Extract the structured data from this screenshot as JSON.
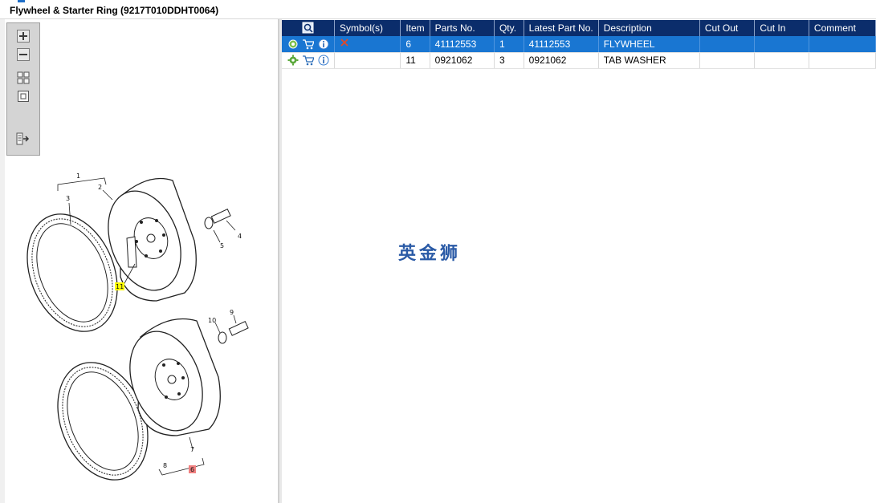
{
  "window": {
    "title": "Flywheel & Starter Ring (9217T010DDHT0064)"
  },
  "zoom_toolbar": {
    "buttons": [
      {
        "name": "zoom-in-icon"
      },
      {
        "name": "zoom-out-icon"
      },
      {
        "name": "fit-all-icon"
      },
      {
        "name": "actual-size-icon"
      },
      {
        "name": "export-icon"
      }
    ]
  },
  "diagram": {
    "callouts": [
      "1",
      "2",
      "3",
      "4",
      "5",
      "6",
      "7",
      "8",
      "9",
      "10",
      "11"
    ],
    "highlight_yellow": "11",
    "highlight_red": "6"
  },
  "grid": {
    "columns": [
      "Symbol(s)",
      "Item",
      "Parts No.",
      "Qty.",
      "Latest Part No.",
      "Description",
      "Cut Out",
      "Cut In",
      "Comment"
    ],
    "rows": [
      {
        "item": "6",
        "parts_no": "41112553",
        "qty": "1",
        "latest": "41112553",
        "description": "FLYWHEEL",
        "cut_out": "",
        "cut_in": "",
        "comment": "",
        "selected": true,
        "symbol": "red-cross-icon"
      },
      {
        "item": "11",
        "parts_no": "0921062",
        "qty": "3",
        "latest": "0921062",
        "description": "TAB WASHER",
        "cut_out": "",
        "cut_in": "",
        "comment": "",
        "selected": false,
        "symbol": ""
      }
    ]
  },
  "watermark": "英金狮",
  "colors": {
    "header_bg": "#0b2d6b",
    "selected_row": "#1976d2",
    "callout_yellow": "#ffff00",
    "callout_red": "#f08080"
  }
}
